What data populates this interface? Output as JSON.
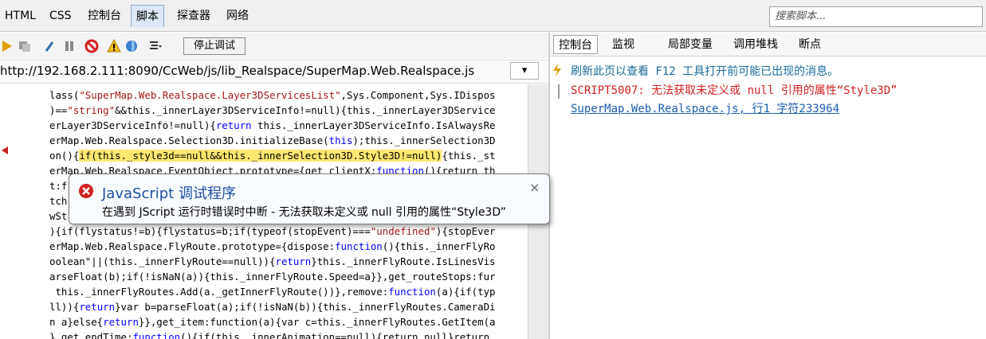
{
  "top_tabs": [
    {
      "label": "HTML"
    },
    {
      "label": "CSS"
    },
    {
      "label": "控制台"
    },
    {
      "label": "脚本"
    },
    {
      "label": "探查器"
    },
    {
      "label": "网络"
    }
  ],
  "search": {
    "placeholder": "搜索脚本..."
  },
  "toolbar": {
    "stop_label": "停止调试"
  },
  "url": {
    "text": "http://192.168.2.111:8090/CcWeb/js/lib_Realspace/SuperMap.Web.Realspace.js"
  },
  "code_lines": [
    {
      "a": "lass(",
      "s": "\"SuperMap.Web.Realspace.Layer3DServicesList\"",
      "b": ",Sys.Component,Sys.IDispos"
    },
    {
      "a": ")==",
      "s": "\"string\"",
      "b": "&&this._innerLayer3DServiceInfo!=null){this._innerLayer3DService"
    },
    {
      "a": "erLayer3DServiceInfo!=null){",
      "k": "return",
      "b": " this._innerLayer3DServiceInfo.IsAlwaysRe"
    },
    {
      "a": "erMap.Web.Realspace.Selection3D.initializeBase(",
      "k": "this",
      "b": ");this._innerSelection3D"
    },
    {
      "a": "on(){",
      "h": "if(this._style3d==null&&this._innerSelection3D.Style3D!=null)",
      "b": "{this._st"
    },
    {
      "a": "erMap.Web.Realspace.EventObject.prototype={get_clientX:",
      "k": "function",
      "b": "(){return th"
    },
    {
      "a": "t:f",
      "b": ""
    },
    {
      "a": "tch",
      "b": ""
    },
    {
      "a": "wSt",
      "b": ""
    },
    {
      "a": "){if(flystatus!=b){flystatus=b;if(typeof(stopEvent)===",
      "s": "\"undefined\"",
      "b": "){stopEver"
    },
    {
      "a": "erMap.Web.Realspace.FlyRoute.prototype={dispose:",
      "k": "function",
      "b": "(){this._innerFlyRo"
    },
    {
      "a": "oolean\"||(this._innerFlyRoute==null)){",
      "k": "return",
      "b": "}this._innerFlyRoute.IsLinesVis"
    },
    {
      "a": "arseFloat(b);if(!isNaN(a)){this._innerFlyRoute.Speed=a}},get_routeStops:fur",
      "b": ""
    },
    {
      "a": " this._innerFlyRoutes.Add(a._getInnerFlyRoute())},remove:",
      "k": "function",
      "b": "(a){if(typ"
    },
    {
      "a": "ll)){",
      "k": "return",
      "b": "}var b=parseFloat(a);if(!isNaN(b)){this._innerFlyRoutes.CameraDi"
    },
    {
      "a": "n a}else{",
      "k": "return",
      "b": "}},get_item:function(a){var c=this._innerFlyRoutes.GetItem(a"
    },
    {
      "a": "},get_endTime:",
      "k": "function",
      "b": "(){if(this._innerAnimation==null){return null}return"
    }
  ],
  "console_tabs": [
    {
      "label": "控制台"
    },
    {
      "label": "监视"
    },
    {
      "label": "局部变量"
    },
    {
      "label": "调用堆栈"
    },
    {
      "label": "断点"
    }
  ],
  "console": {
    "info": "刷新此页以查看 F12 工具打开前可能已出现的消息。",
    "error": "SCRIPT5007: 无法获取未定义或 null 引用的属性“Style3D”",
    "link": "SuperMap.Web.Realspace.js, 行1 字符233964"
  },
  "popup": {
    "title": "JavaScript 调试程序",
    "message": "在遇到 JScript 运行时错误时中断 - 无法获取未定义或 null 引用的属性“Style3D”"
  },
  "colors": {
    "error": "#d42020",
    "link": "#1a5fb4",
    "info": "#1a6a9a",
    "highlight": "#ffe770"
  }
}
